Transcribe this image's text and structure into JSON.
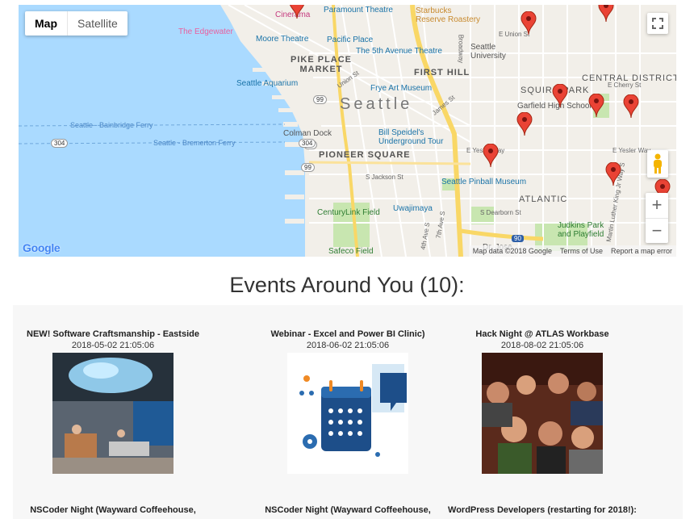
{
  "map": {
    "type_buttons": {
      "map": "Map",
      "satellite": "Satellite"
    },
    "attribution": {
      "data": "Map data ©2018 Google",
      "terms": "Terms of Use",
      "report": "Report a map error"
    },
    "logo": "Google",
    "labels": {
      "cinerama": "Cinerama",
      "paramount": "Paramount Theatre",
      "starbucks": "Starbucks\nReserve Roastery",
      "edgewater": "The Edgewater",
      "moore": "Moore Theatre",
      "pacific_place": "Pacific Place",
      "fifth_ave": "The 5th Avenue Theatre",
      "pike_place": "PIKE PLACE\nMARKET",
      "first_hill": "FIRST HILL",
      "seattle_univ": "Seattle\nUniversity",
      "central_district": "CENTRAL DISTRICT",
      "aquarium": "Seattle Aquarium",
      "frye": "Frye Art Museum",
      "seattle": "Seattle",
      "squire_park": "SQUIRE PARK",
      "garfield": "Garfield High School",
      "bainbridge": "Seattle - Bainbridge Ferry",
      "colman": "Colman Dock",
      "speidel": "Bill Speidel's\nUnderground Tour",
      "bremerton": "Seattle - Bremerton Ferry",
      "pioneer": "PIONEER SQUARE",
      "pinball": "Seattle Pinball Museum",
      "atlantic": "ATLANTIC",
      "centurylink": "CenturyLink Field",
      "uwajimaya": "Uwajimaya",
      "judkins": "Judkins Park\nand Playfield",
      "safeco": "Safeco Field",
      "jose": "Dr. Jose"
    },
    "street_labels": {
      "e_union": "E Union St",
      "e_cherry": "E Cherry St",
      "e_yesler": "E Yesler Way",
      "e_yesler2": "E Yesler Way",
      "s_jackson": "S Jackson St",
      "s_dearborn": "S Dearborn St",
      "james": "James St",
      "union": "Union St",
      "broadway": "Broadway",
      "mlk": "Martin Luther King Jr Way S",
      "fourth_ave": "4th Ave S",
      "seventh_ave": "7th Ave S",
      "r99a": "99",
      "r99b": "99",
      "r99c": "99",
      "r304a": "304",
      "r304b": "304",
      "i90": "90"
    }
  },
  "events": {
    "title": "Events Around You (10):",
    "items": [
      {
        "title": "NEW! Software Craftsmanship - Eastside",
        "date": "2018-05-02 21:05:06",
        "image": "office-interior-photo"
      },
      {
        "title": "Webinar - Excel and Power BI Clinic)",
        "date": "2018-06-02 21:05:06",
        "image": "calendar-illustration"
      },
      {
        "title": "Hack Night @ ATLAS Workbase",
        "date": "2018-08-02 21:05:06",
        "image": "crowd-photo"
      },
      {
        "title": "NSCoder Night (Wayward Coffeehouse,",
        "date": "",
        "image": ""
      },
      {
        "title": "NSCoder Night (Wayward Coffeehouse,",
        "date": "",
        "image": ""
      },
      {
        "title": "WordPress Developers (restarting for 2018!):",
        "date": "",
        "image": ""
      }
    ]
  },
  "colors": {
    "water": "#aadaff",
    "land": "#f2efe9",
    "park": "#c8e6b0",
    "highway": "#f9d766",
    "pin": "#ea4335"
  }
}
